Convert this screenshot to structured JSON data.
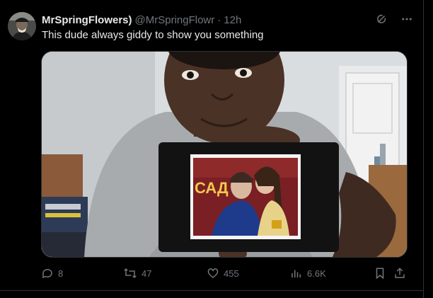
{
  "tweet": {
    "display_name": "MrSpringFlowers)",
    "handle": "@MrSpringFlowr",
    "separator": "·",
    "time": "12h",
    "text": "This dude always giddy to show you something"
  },
  "media": {
    "photo_sign_text": "САД"
  },
  "actions": {
    "replies": "8",
    "reposts": "47",
    "likes": "455",
    "views": "6.6K"
  },
  "icons": {
    "grok": "grok-icon",
    "more": "more-icon",
    "reply": "reply-icon",
    "repost": "repost-icon",
    "like": "like-icon",
    "views": "views-icon",
    "bookmark": "bookmark-icon",
    "share": "share-icon"
  },
  "colors": {
    "background": "#000000",
    "text": "#e7e9ea",
    "muted": "#71767b",
    "border": "#2f3336"
  }
}
